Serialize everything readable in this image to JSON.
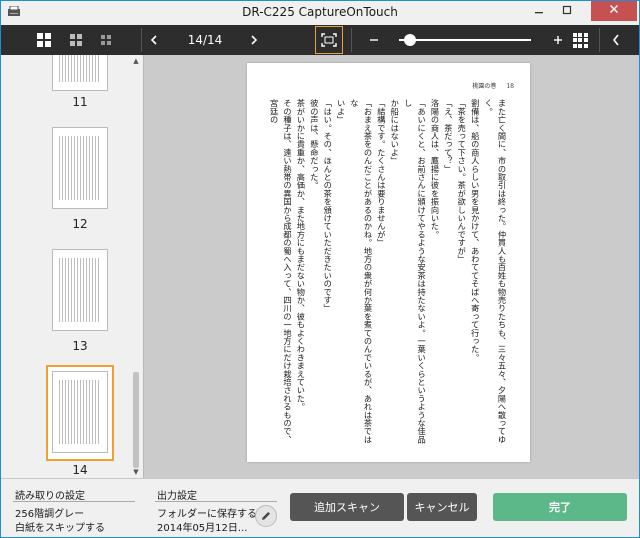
{
  "window": {
    "title": "DR-C225 CaptureOnTouch"
  },
  "toolbar": {
    "page_counter": "14/14"
  },
  "thumbnails": [
    {
      "number": "11"
    },
    {
      "number": "12"
    },
    {
      "number": "13"
    },
    {
      "number": "14",
      "selected": true
    }
  ],
  "zoom": {
    "level": 0.04
  },
  "page": {
    "header_title": "桃園の巻",
    "header_page": "18",
    "body_lines": [
      "また亡く間に、市の取引は終った。仲買人も百姓も物売りたちも、三々五々、夕陽へ散ってゆ",
      "く。",
      "劉備は、船の商人らしい男を見かけて、あわててそばへ寄って行った。",
      "「茶を売って下さい。茶が欲しいんですが」",
      "「え、茶だって？」",
      "洛陽の商人は、鷹揚に彼を振向いた。",
      "「あいにくと、お前さんに頒けてやるような安茶は持たないよ。一葉いくらというような佳品し",
      "か船にはないよ」",
      "「結構です。たくさんは要りませんが」",
      "「おまえ茶をのんだことがあるのかね。地方の衆が何か葉を煮てのんでいるが、あれは茶ではな",
      "いよ」",
      "「はい。その、ほんとの茶を頒けていただきたいのです」",
      "彼の声は、懸命だった。",
      "茶がいかに貴重か、高価か、また地方にもまだない物か、彼もよくわきまえていた。",
      "その種子は、遠い熱帯の異国から成都の蜀へ入って、四川の一地方にだけ栽培されるもので、宮廷の",
      "なれば、漢の代々の天子も、後宮の寵姫に少し与えられるほど、民間の富豪で漢人の所有地まれに",
      "れに栽培されるようになったとも聞いていた。",
      "また別な説には、一日に百草を嘗めて人間に食物を教えた神農はたびたび毒草にあたった",
      "が、茶を得てからそれを嚙むとたちまち毒をけしたので、以来、秘愛せられたとも伝えられてい"
    ]
  },
  "bottom": {
    "scan_settings": {
      "title": "読み取りの設定",
      "line1": "256階調グレー",
      "line2": "白紙をスキップする"
    },
    "output_settings": {
      "title": "出力設定",
      "line1": "フォルダーに保存する",
      "line2": "2014年05月12日..."
    },
    "buttons": {
      "add_scan": "追加スキャン",
      "cancel": "キャンセル",
      "done": "完了"
    }
  },
  "colors": {
    "accent_orange": "#f0a030",
    "done_green": "#5cb888",
    "toolbar_dark": "#2d2d2d",
    "close_red": "#c75050"
  }
}
